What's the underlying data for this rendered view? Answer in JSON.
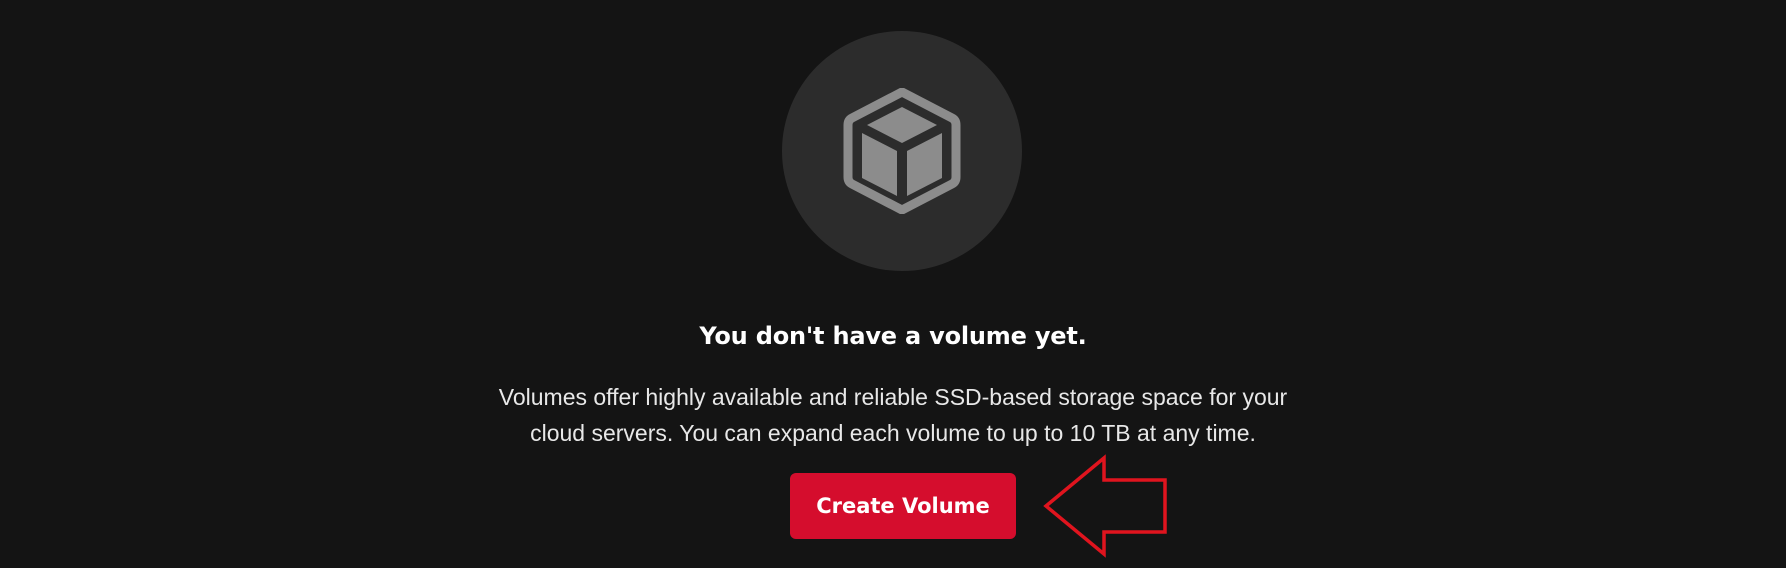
{
  "empty_state": {
    "icon": "cube-icon",
    "title": "You don't have a volume yet.",
    "description_line1": "Volumes offer highly available and reliable SSD-based storage space for your",
    "description_line2": "cloud servers. You can expand each volume to up to 10 TB at any time.",
    "create_button_label": "Create Volume"
  },
  "annotation": {
    "icon": "left-arrow-outline-icon",
    "color": "#e0141e"
  },
  "colors": {
    "background": "#141414",
    "icon_circle": "#2c2c2c",
    "icon_fill": "#8c8c8c",
    "icon_stroke": "#2c2c2c",
    "accent": "#d50d2d"
  }
}
